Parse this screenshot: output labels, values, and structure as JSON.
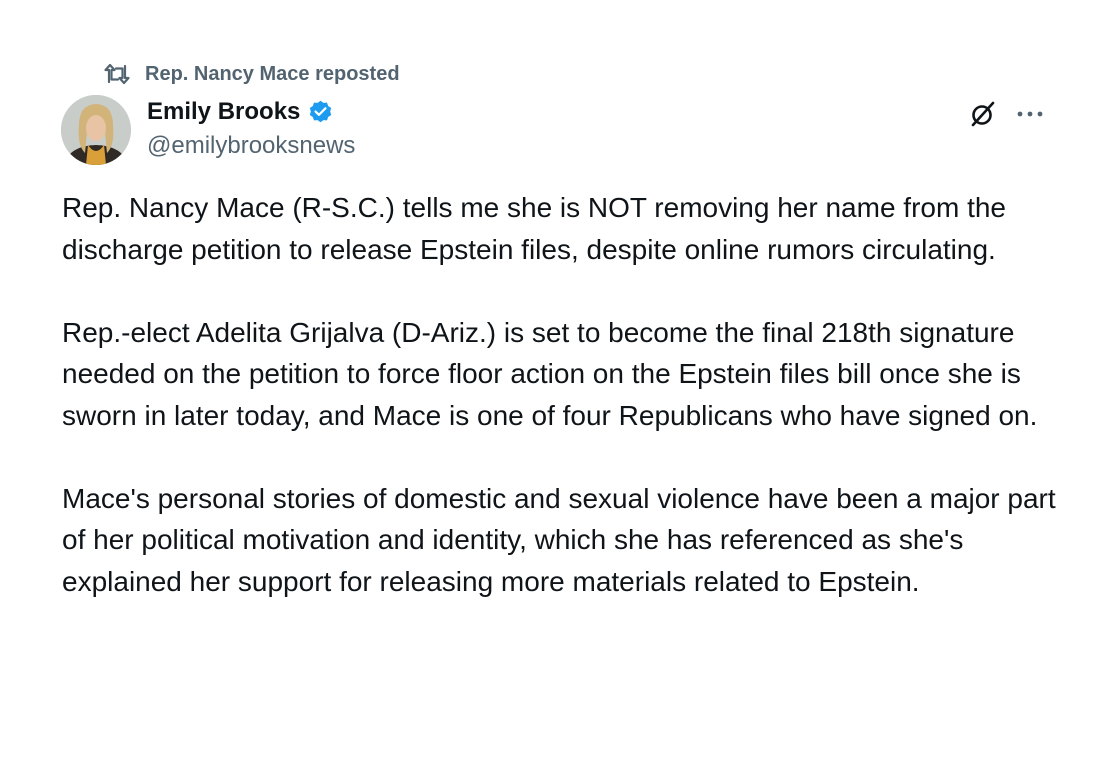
{
  "repost": {
    "label": "Rep. Nancy Mace reposted",
    "icon": "repost-icon"
  },
  "author": {
    "name": "Emily Brooks",
    "handle": "@emilybrooksnews",
    "verified": true,
    "verified_color": "#1d9bf0"
  },
  "actions": {
    "grok_icon": "grok-icon",
    "more_icon": "more-options-icon"
  },
  "tweet": {
    "paragraphs": [
      "Rep. Nancy Mace (R-S.C.) tells me she is NOT removing her name from the discharge petition to release Epstein files, despite online rumors circulating.",
      "Rep.-elect Adelita Grijalva (D-Ariz.) is set to become the final 218th signature needed on the petition to force floor action on the Epstein files bill once she is sworn in later today, and Mace is one of four Republicans who have signed on.",
      "Mace's personal stories of domestic and sexual violence have been a major part of her political motivation and identity, which she has referenced as she's explained her support for releasing more materials related to Epstein."
    ]
  },
  "colors": {
    "text_primary": "#0f1419",
    "text_secondary": "#536471",
    "background": "#ffffff"
  }
}
